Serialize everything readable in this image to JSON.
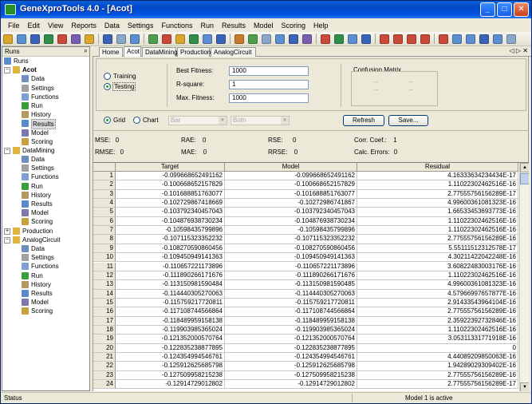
{
  "window": {
    "title": "GeneXproTools 4.0 - [Acot]",
    "minimize": "_",
    "maximize": "□",
    "close": "✕"
  },
  "menu": [
    "File",
    "Edit",
    "View",
    "Reports",
    "Data",
    "Settings",
    "Functions",
    "Run",
    "Results",
    "Model",
    "Scoring",
    "Help"
  ],
  "runs_panel": {
    "title": "Runs",
    "pin": "ᵖ",
    "root": "Runs",
    "groups": [
      {
        "name": "Acot",
        "bold": true,
        "children": [
          "Data",
          "Settings",
          "Functions",
          "Run",
          "History",
          "Results",
          "Model",
          "Scoring"
        ],
        "selected": "Results"
      },
      {
        "name": "DataMining",
        "bold": false,
        "children": [
          "Data",
          "Settings",
          "Functions",
          "Run",
          "History",
          "Results",
          "Model",
          "Scoring"
        ]
      },
      {
        "name": "Production",
        "bold": false,
        "children": []
      },
      {
        "name": "AnalogCircuit",
        "bold": false,
        "children": [
          "Data",
          "Settings",
          "Functions",
          "Run",
          "History",
          "Results",
          "Model",
          "Scoring"
        ]
      }
    ]
  },
  "tabs": [
    "Home",
    "Acot",
    "DataMining",
    "Production",
    "AnalogCircuit"
  ],
  "active_tab": "Acot",
  "tab_nav": "◁ ▷ ✕",
  "options": {
    "training_label": "Training",
    "testing_label": "Testing",
    "selected": "Testing"
  },
  "fitness": {
    "best_fitness_label": "Best Fitness:",
    "best_fitness_value": "1000",
    "rsquare_label": "R-square:",
    "rsquare_value": "1",
    "max_fitness_label": "Max. Fitness:",
    "max_fitness_value": "1000"
  },
  "confusion": {
    "title": "Confusion Matrix",
    "cells": [
      "--",
      "--",
      "--",
      "--"
    ]
  },
  "view": {
    "grid_label": "Grid",
    "chart_label": "Chart",
    "selected": "Grid",
    "chart_type": "Bar",
    "chart_series": "Both",
    "refresh_label": "Refresh",
    "save_label": "Save..."
  },
  "stats": {
    "mse": "MSE:",
    "mse_v": "0",
    "rmse": "RMSE:",
    "rmse_v": "0",
    "rae": "RAE:",
    "rae_v": "0",
    "mae": "MAE:",
    "mae_v": "0",
    "rse": "RSE:",
    "rse_v": "0",
    "rrse": "RRSE:",
    "rrse_v": "0",
    "corr": "Corr. Coef.:",
    "corr_v": "1",
    "calc": "Calc. Errors:",
    "calc_v": "0"
  },
  "grid": {
    "columns": [
      "",
      "Target",
      "Model",
      "Residual"
    ],
    "rows": [
      [
        "1",
        "-0.099668652491162",
        "-0.099668652491162",
        "4.16333634234434E-17"
      ],
      [
        "2",
        "-0.100668652157829",
        "-0.100668652157829",
        "1.11022302462516E-16"
      ],
      [
        "3",
        "-0.101688851763077",
        "-0.101688851763077",
        "2.77555756156289E-17"
      ],
      [
        "4",
        "-0.102729867418669",
        "-0.10272986741867",
        "4.99600361081323E-16"
      ],
      [
        "5",
        "-0.103792340457043",
        "-0.103792340457043",
        "1.66533453693773E-16"
      ],
      [
        "6",
        "-0.104876938730234",
        "-0.104876938730234",
        "1.11022302462516E-16"
      ],
      [
        "7",
        "-0.10598435799896",
        "-0.10598435799896",
        "1.11022302462516E-16"
      ],
      [
        "8",
        "-0.107115323352232",
        "-0.107115323352232",
        "2.77555756156289E-16"
      ],
      [
        "9",
        "-0.108270590860456",
        "-0.108270590860456",
        "5.55111512312578E-17"
      ],
      [
        "10",
        "-0.109450949141363",
        "-0.109450949141363",
        "4.30211422042248E-16"
      ],
      [
        "11",
        "-0.110657221173896",
        "-0.110657221173896",
        "3.60822483003176E-16"
      ],
      [
        "12",
        "-0.111890266171676",
        "-0.111890266171676",
        "1.11022302462516E-16"
      ],
      [
        "13",
        "-0.113150981590484",
        "-0.113150981590485",
        "4.99600361081323E-16"
      ],
      [
        "14",
        "-0.114440305270063",
        "-0.114440305270063",
        "4.57966997657877E-16"
      ],
      [
        "15",
        "-0.115759217720811",
        "-0.115759217720811",
        "2.91433543964104E-16"
      ],
      [
        "16",
        "-0.117108744566864",
        "-0.117108744566864",
        "2.77555756156289E-16"
      ],
      [
        "17",
        "-0.118489959158138",
        "-0.118489959158138",
        "2.35922392732846E-16"
      ],
      [
        "18",
        "-0.119903985365024",
        "-0.119903985365024",
        "1.11022302462516E-16"
      ],
      [
        "19",
        "-0.121352000570764",
        "-0.121352000570764",
        "3.05311331771918E-16"
      ],
      [
        "20",
        "-0.122835238877895",
        "-0.122835238877895",
        "0"
      ],
      [
        "21",
        "-0.124354994546761",
        "-0.124354994546761",
        "4.44089209850063E-16"
      ],
      [
        "22",
        "-0.125912625685798",
        "-0.125912625685798",
        "1.94289029309402E-16"
      ],
      [
        "23",
        "-0.127509958215238",
        "-0.127509958215238",
        "2.77555756156289E-16"
      ],
      [
        "24",
        "-0.12914729012802",
        "-0.12914729012802",
        "2.77555756156289E-17"
      ]
    ]
  },
  "statusbar": {
    "left": "Status",
    "right": "Model 1 is active"
  }
}
